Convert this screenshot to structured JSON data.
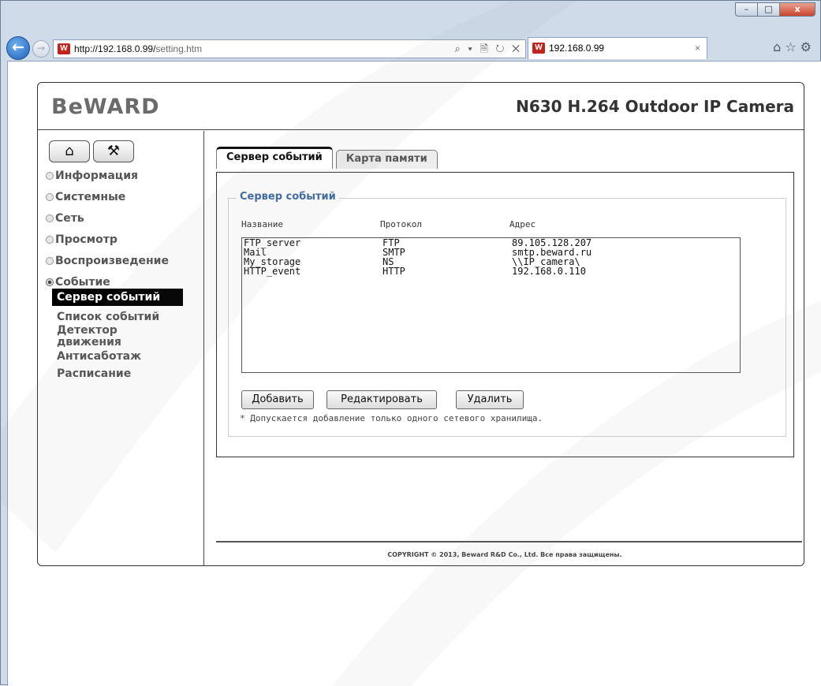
{
  "browser": {
    "url_host": "http://192.168.0.99/",
    "url_path": "setting.htm",
    "address_tools": "⌕ ▾ 🗎 ↻ ✕",
    "tab_title": "192.168.0.99",
    "tab_close": "×",
    "favicon_letter": "W",
    "window_controls": {
      "minimize": "–",
      "maximize": "□",
      "close": "x"
    },
    "nav": {
      "back": "←",
      "forward": "→"
    },
    "toolbar_icons": {
      "home": "⌂",
      "favorites": "☆",
      "tools": "⚙"
    }
  },
  "camera": {
    "logo": "BeWARD",
    "model": "N630 H.264 Outdoor IP Camera"
  },
  "quick_buttons": {
    "home": "⌂",
    "settings": "⚒"
  },
  "menu": {
    "items": [
      {
        "label": "Информация",
        "expanded": false
      },
      {
        "label": "Системные",
        "expanded": false
      },
      {
        "label": "Сеть",
        "expanded": false
      },
      {
        "label": "Просмотр",
        "expanded": false
      },
      {
        "label": "Воспроизведение",
        "expanded": false
      },
      {
        "label": "Событие",
        "expanded": true
      }
    ],
    "sub_items": [
      {
        "label": "Сервер событий",
        "active": true
      },
      {
        "label": "Список событий",
        "active": false
      },
      {
        "label": "Детектор движения",
        "active": false
      },
      {
        "label": "Антисаботаж",
        "active": false
      },
      {
        "label": "Расписание",
        "active": false
      }
    ]
  },
  "tabs": [
    {
      "label": "Сервер событий",
      "active": true
    },
    {
      "label": "Карта памяти",
      "active": false
    }
  ],
  "section": {
    "legend": "Сервер событий",
    "columns": [
      "Название",
      "Протокол",
      "Адрес"
    ],
    "rows": [
      {
        "name": "FTP_server",
        "protocol": "FTP",
        "address": "89.105.128.207"
      },
      {
        "name": "Mail",
        "protocol": "SMTP",
        "address": "smtp.beward.ru"
      },
      {
        "name": "My_storage",
        "protocol": "NS",
        "address": "\\\\IP_camera\\"
      },
      {
        "name": "HTTP_event",
        "protocol": "HTTP",
        "address": "192.168.0.110"
      }
    ],
    "buttons": {
      "add": "Добавить",
      "edit": "Редактировать",
      "delete": "Удалить"
    },
    "note": "* Допускается добавление только одного сетевого хранилища."
  },
  "footer": {
    "copyright": "COPYRIGHT © 2013, Beward R&D Co., Ltd. Все права защищены."
  },
  "colors": {
    "legend": "#3d6ba3",
    "active_menu_bg": "#000000",
    "watermark": "#f2f2f2"
  }
}
